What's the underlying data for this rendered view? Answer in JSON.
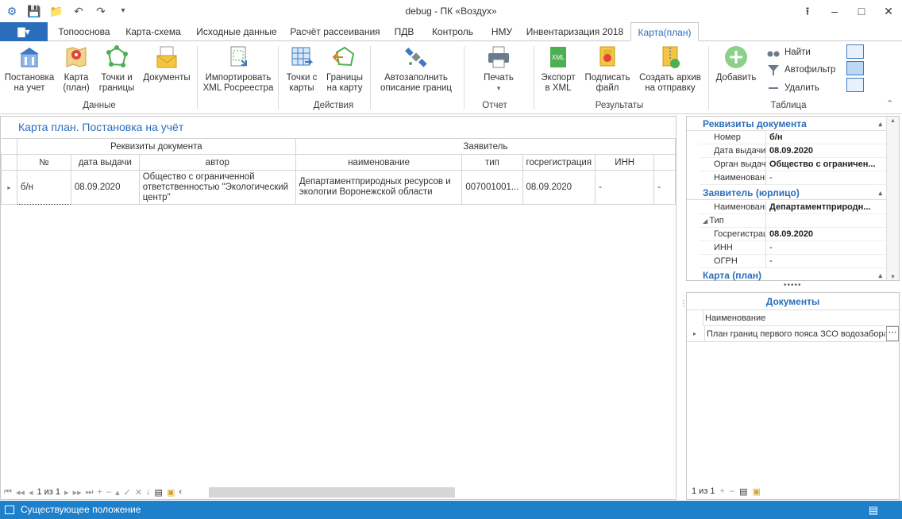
{
  "window": {
    "title": "debug - ПК «Воздух»"
  },
  "file_tab": "▇▾",
  "tabs": [
    "Топооснова",
    "Карта-схема",
    "Исходные данные",
    "Расчёт рассеивания",
    "ПДВ",
    "Контроль",
    "НМУ",
    "Инвентаризация 2018",
    "Карта(план)"
  ],
  "ribbon": {
    "data": {
      "group": "Данные",
      "btn1": "Постановка на учет",
      "btn2": "Карта (план)",
      "btn3": "Точки и границы",
      "btn4": "Документы"
    },
    "actions": {
      "group": "Действия",
      "btn1": "Импортировать XML Росреестра",
      "btn2": "Точки с карты",
      "btn3": "Границы на карту",
      "btn4": "Автозаполнить описание границ"
    },
    "report": {
      "group": "Отчет",
      "btn1": "Печать"
    },
    "results": {
      "group": "Результаты",
      "btn1": "Экспорт в XML",
      "btn2": "Подписать файл",
      "btn3": "Создать архив на отправку"
    },
    "table": {
      "group": "Таблица",
      "add": "Добавить",
      "find": "Найти",
      "autofilter": "Автофильтр",
      "delete": "Удалить"
    }
  },
  "main": {
    "title": "Карта план. Постановка на учёт",
    "band1": "Реквизиты документа",
    "band2": "Заявитель",
    "cols": [
      "№",
      "дата выдачи",
      "автор",
      "наименование",
      "тип",
      "госрегистрация",
      "ИНН"
    ],
    "row": [
      "б/н",
      "08.09.2020",
      "Общество с ограниченной ответственностью \"Экологический центр\"",
      "Департаментприродных ресурсов и экологии Воронежской области",
      "007001001...",
      "08.09.2020",
      "-",
      "-"
    ],
    "pager": "1 из 1"
  },
  "props": {
    "sec1": "Реквизиты документа",
    "rows1": [
      [
        "Номер",
        "б/н"
      ],
      [
        "Дата выдачи",
        "08.09.2020"
      ],
      [
        "Орган выдачи",
        "Общество с ограничен..."
      ],
      [
        "Наименование",
        "-"
      ]
    ],
    "sec2": "Заявитель (юрлицо)",
    "rows2": [
      [
        "Наименование",
        "Департаментприродн..."
      ],
      [
        "Тип",
        ""
      ],
      [
        "Госрегистрация",
        "08.09.2020"
      ],
      [
        "ИНН",
        "-"
      ],
      [
        "ОГРН",
        "-"
      ]
    ],
    "sec3": "Карта (план)"
  },
  "docs": {
    "title": "Документы",
    "col": "Наименование",
    "row": "План границ первого пояса ЗСО водозабора",
    "pager": "1 из 1"
  },
  "status": "Существующее положение"
}
